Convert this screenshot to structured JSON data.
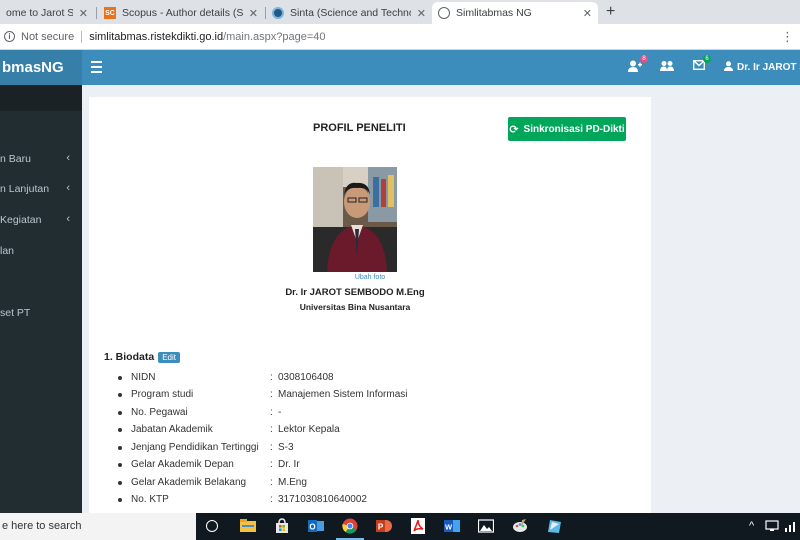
{
  "browser": {
    "tabs": [
      {
        "title": "ome to Jarot Suroso",
        "favicon": "globe"
      },
      {
        "title": "Scopus - Author details (Suroso,",
        "favicon": "scopus"
      },
      {
        "title": "Sinta (Science and Technology In",
        "favicon": "sinta"
      },
      {
        "title": "Simlitabmas NG",
        "favicon": "globe",
        "active": true
      }
    ],
    "favicon_sc": "SC",
    "close_glyph": "✕",
    "new_tab": "+",
    "security": "Not secure",
    "url_host": "simlitabmas.ristekdikti.go.id",
    "url_path": "/main.aspx?page=40"
  },
  "app": {
    "logo": "bmasNG",
    "header_color": "#3c8dbc",
    "badges": [
      "8",
      "6"
    ],
    "user_name": "Dr. Ir JAROT SE"
  },
  "sidebar": {
    "items": [
      {
        "label": "n Baru"
      },
      {
        "label": "n Lanjutan"
      },
      {
        "label": "Kegiatan"
      },
      {
        "label": "lan"
      },
      {
        "label": "set PT"
      }
    ],
    "chevron": "‹"
  },
  "profile": {
    "title": "PROFIL PENELITI",
    "sync_button": "Sinkronisasi PD-Dikti",
    "sync_color": "#00a65a",
    "change_photo": "Ubah foto",
    "name": "Dr. Ir JAROT SEMBODO M.Eng",
    "university": "Universitas Bina Nusantara"
  },
  "biodata": {
    "heading": "1. Biodata",
    "edit_label": "Edit",
    "rows": [
      {
        "label": "NIDN",
        "value": "0308106408"
      },
      {
        "label": "Program studi",
        "value": "Manajemen Sistem Informasi"
      },
      {
        "label": "No. Pegawai",
        "value": "-"
      },
      {
        "label": "Jabatan Akademik",
        "value": "Lektor Kepala"
      },
      {
        "label": "Jenjang Pendidikan Tertinggi",
        "value": "S-3"
      },
      {
        "label": "Gelar Akademik Depan",
        "value": "Dr. Ir"
      },
      {
        "label": "Gelar Akademik Belakang",
        "value": "M.Eng"
      },
      {
        "label": "No. KTP",
        "value": "3171030810640002"
      }
    ]
  },
  "taskbar": {
    "search_placeholder": "e here to search"
  }
}
